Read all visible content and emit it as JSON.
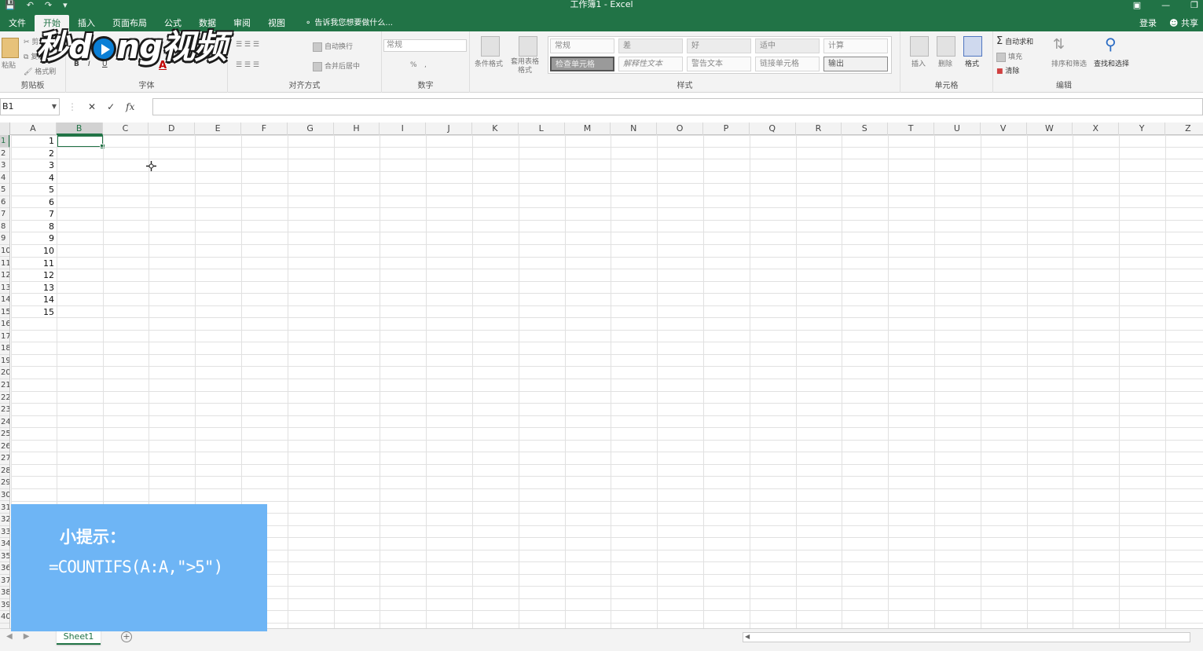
{
  "titlebar": {
    "title": "工作簿1 - Excel",
    "qat": [
      "save",
      "undo",
      "redo",
      "customize"
    ],
    "window_controls": [
      "ribbon-display",
      "minimize",
      "restore"
    ]
  },
  "tabs": [
    "文件",
    "开始",
    "插入",
    "页面布局",
    "公式",
    "数据",
    "审阅",
    "视图"
  ],
  "active_tab": "开始",
  "tell_me": "告诉我您想要做什么...",
  "account": {
    "signin": "登录",
    "share": "共享"
  },
  "ribbon": {
    "clipboard": {
      "label": "剪贴板",
      "paste": "粘贴",
      "cut": "剪切",
      "copy": "复制",
      "format_painter": "格式刷"
    },
    "font": {
      "label": "字体",
      "bold": "B",
      "italic": "I",
      "underline": "U",
      "font_color": "A"
    },
    "alignment": {
      "label": "对齐方式",
      "wrap": "自动换行",
      "merge": "合并后居中"
    },
    "number": {
      "label": "数字",
      "format": "常规",
      "percent": "%",
      "comma": ","
    },
    "styles": {
      "label": "样式",
      "conditional": "条件格式",
      "table": "套用表格格式",
      "cells": [
        "常规",
        "差",
        "好",
        "适中",
        "计算",
        "检查单元格",
        "解释性文本",
        "警告文本",
        "链接单元格",
        "输出"
      ]
    },
    "cells_group": {
      "label": "单元格",
      "insert": "插入",
      "delete": "删除",
      "format": "格式"
    },
    "editing": {
      "label": "编辑",
      "autosum": "自动求和",
      "fill": "填充",
      "clear": "清除",
      "sort": "排序和筛选",
      "find": "查找和选择"
    }
  },
  "watermark": "秒懂视频",
  "formula_bar": {
    "name_box": "B1",
    "cancel": "✕",
    "enter": "✓",
    "fx": "fx",
    "content": ""
  },
  "columns": [
    "A",
    "B",
    "C",
    "D",
    "E",
    "F",
    "G",
    "H",
    "I",
    "J",
    "K",
    "L",
    "M",
    "N",
    "O",
    "P",
    "Q",
    "R",
    "S",
    "T",
    "U",
    "V",
    "W",
    "X",
    "Y",
    "Z"
  ],
  "selected_column": "B",
  "rows": [
    "1",
    "2",
    "3",
    "4",
    "5",
    "6",
    "7",
    "8",
    "9",
    "10",
    "11",
    "12",
    "13",
    "14",
    "15",
    "16",
    "17",
    "18",
    "19",
    "20",
    "21",
    "22",
    "23",
    "24",
    "25",
    "26",
    "27",
    "28",
    "29",
    "30",
    "31",
    "32",
    "33",
    "34",
    "35",
    "36",
    "37",
    "38",
    "39",
    "40"
  ],
  "column_a_values": [
    "1",
    "2",
    "3",
    "4",
    "5",
    "6",
    "7",
    "8",
    "9",
    "10",
    "11",
    "12",
    "13",
    "14",
    "15"
  ],
  "tip": {
    "title": "小提示：",
    "formula": "=COUNTIFS(A:A,\">5\")"
  },
  "sheets": [
    "Sheet1"
  ],
  "colors": {
    "excel_green": "#217346",
    "tip_blue": "#6eb5f5"
  }
}
